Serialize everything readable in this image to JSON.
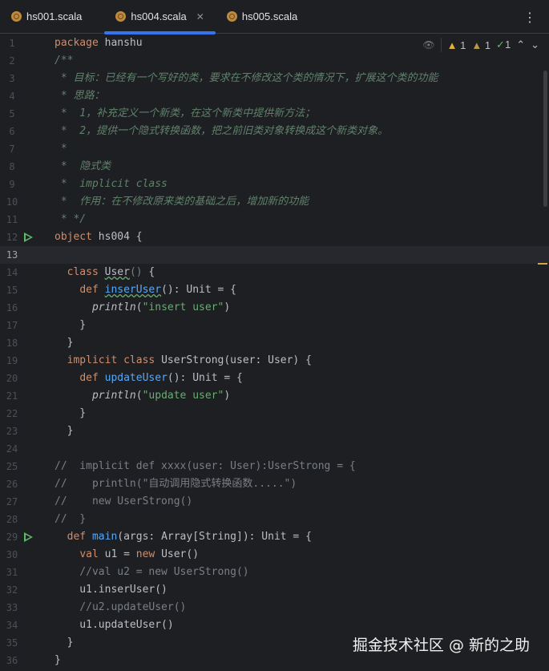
{
  "tabs": [
    {
      "label": "hs001.scala",
      "active": false
    },
    {
      "label": "hs004.scala",
      "active": true,
      "close": "✕"
    },
    {
      "label": "hs005.scala",
      "active": false
    }
  ],
  "more_icon": "⋮",
  "inspections": {
    "eye": "👁",
    "warn1": "1",
    "warn2": "1",
    "ok": "1",
    "up": "⌃",
    "down": "⌄"
  },
  "current_line": 13,
  "run_lines": [
    12,
    29
  ],
  "lines": [
    [
      [
        "package",
        "kw"
      ],
      [
        " hanshu",
        ""
      ]
    ],
    [
      [
        "/**",
        "dc"
      ]
    ],
    [
      [
        " * 目标：已经有一个写好的类，要求在不修改这个类的情况下，扩展这个类的功能",
        "dc"
      ]
    ],
    [
      [
        " * 思路：",
        "dc"
      ]
    ],
    [
      [
        " *  1，补充定义一个新类，在这个新类中提供新方法；",
        "dc"
      ]
    ],
    [
      [
        " *  2，提供一个隐式转换函数，把之前旧类对象转换成这个新类对象。",
        "dc"
      ]
    ],
    [
      [
        " *",
        "dc"
      ]
    ],
    [
      [
        " *  隐式类",
        "dc"
      ]
    ],
    [
      [
        " *  implicit class",
        "dc"
      ]
    ],
    [
      [
        " *  作用：在不修改原来类的基础之后，增加新的功能",
        "dc"
      ]
    ],
    [
      [
        " * */",
        "dc"
      ]
    ],
    [
      [
        "object",
        "kw"
      ],
      [
        " hs004 {",
        ""
      ]
    ],
    [],
    [
      [
        "  ",
        ""
      ],
      [
        "class",
        "kw"
      ],
      [
        " ",
        ""
      ],
      [
        "User",
        "wavy"
      ],
      [
        "()",
        "cm"
      ],
      [
        " {",
        ""
      ]
    ],
    [
      [
        "    ",
        ""
      ],
      [
        "def",
        "kw"
      ],
      [
        " ",
        ""
      ],
      [
        "inserUser",
        "fn wavy"
      ],
      [
        "(): Unit = {",
        ""
      ]
    ],
    [
      [
        "      ",
        ""
      ],
      [
        "println",
        "it"
      ],
      [
        "(",
        ""
      ],
      [
        "\"insert user\"",
        "str"
      ],
      [
        ")",
        ""
      ]
    ],
    [
      [
        "    }",
        ""
      ]
    ],
    [
      [
        "  }",
        ""
      ]
    ],
    [
      [
        "  ",
        ""
      ],
      [
        "implicit",
        "kw"
      ],
      [
        " ",
        ""
      ],
      [
        "class",
        "kw"
      ],
      [
        " UserStrong(user: User) {",
        ""
      ]
    ],
    [
      [
        "    ",
        ""
      ],
      [
        "def",
        "kw"
      ],
      [
        " ",
        ""
      ],
      [
        "updateUser",
        "fn"
      ],
      [
        "(): Unit = {",
        ""
      ]
    ],
    [
      [
        "      ",
        ""
      ],
      [
        "println",
        "it"
      ],
      [
        "(",
        ""
      ],
      [
        "\"update user\"",
        "str"
      ],
      [
        ")",
        ""
      ]
    ],
    [
      [
        "    }",
        ""
      ]
    ],
    [
      [
        "  }",
        ""
      ]
    ],
    [],
    [
      [
        "//  implicit def xxxx(user: User):UserStrong = {",
        "cm"
      ]
    ],
    [
      [
        "//    println(\"自动调用隐式转换函数.....\")",
        "cm"
      ]
    ],
    [
      [
        "//    new UserStrong()",
        "cm"
      ]
    ],
    [
      [
        "//  }",
        "cm"
      ]
    ],
    [
      [
        "  ",
        ""
      ],
      [
        "def",
        "kw"
      ],
      [
        " ",
        ""
      ],
      [
        "main",
        "fn"
      ],
      [
        "(args: Array[String]): Unit = {",
        ""
      ]
    ],
    [
      [
        "    ",
        ""
      ],
      [
        "val",
        "kw"
      ],
      [
        " u1 = ",
        ""
      ],
      [
        "new",
        "kw"
      ],
      [
        " User()",
        ""
      ]
    ],
    [
      [
        "    //val u2 = new UserStrong()",
        "cm"
      ]
    ],
    [
      [
        "    u1.inserUser()",
        ""
      ]
    ],
    [
      [
        "    //u2.updateUser()",
        "cm"
      ]
    ],
    [
      [
        "    u1.updateUser()",
        ""
      ]
    ],
    [
      [
        "  }",
        ""
      ]
    ],
    [
      [
        "}",
        ""
      ]
    ]
  ],
  "watermark": "掘金技术社区 @ 新的之助"
}
